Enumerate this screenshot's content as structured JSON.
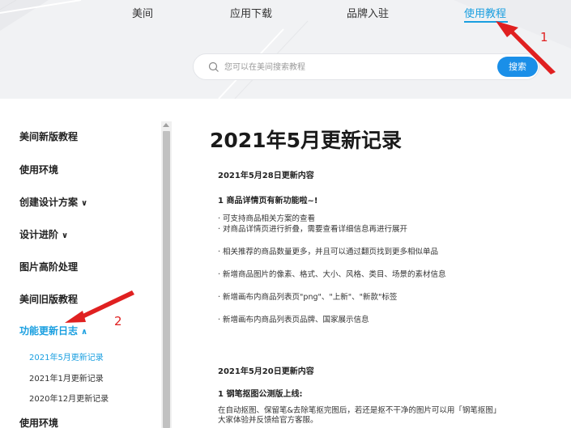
{
  "nav": {
    "items": [
      {
        "label": "美间",
        "active": false
      },
      {
        "label": "应用下载",
        "active": false
      },
      {
        "label": "品牌入驻",
        "active": false
      },
      {
        "label": "使用教程",
        "active": true
      }
    ]
  },
  "search": {
    "placeholder": "您可以在美间搜索教程",
    "button_label": "搜索"
  },
  "sidebar": {
    "items": [
      {
        "label": "美间新版教程"
      },
      {
        "label": "使用环境"
      },
      {
        "label": "创建设计方案",
        "caret": "∨"
      },
      {
        "label": "设计进阶",
        "caret": "∨"
      },
      {
        "label": "图片高阶处理"
      },
      {
        "label": "美间旧版教程"
      },
      {
        "label": "功能更新日志",
        "caret": "∧",
        "active": true
      }
    ],
    "sub_items": [
      {
        "label": "2021年5月更新记录",
        "active": true
      },
      {
        "label": "2021年1月更新记录"
      },
      {
        "label": "2020年12月更新记录"
      }
    ],
    "footer_item": "使用环境"
  },
  "content": {
    "title": "2021年5月更新记录",
    "section1": {
      "heading": "2021年5月28日更新内容",
      "subheading": "1 商品详情页有新功能啦~!",
      "lines": [
        "· 可支持商品相关方案的查看",
        "· 对商品详情页进行折叠，需要查看详细信息再进行展开",
        "· 相关推荐的商品数量更多，并且可以通过翻页找到更多相似单品",
        "· 新增商品图片的像素、格式、大小、风格、类目、场景的素材信息",
        "· 新增画布内商品列表页\"png\"、\"上新\"、\"新款\"标签",
        "· 新增画布内商品列表页品牌、国家展示信息"
      ]
    },
    "section2": {
      "heading": "2021年5月20日更新内容",
      "subheading": "1 钢笔抠图公测版上线:",
      "lines": [
        "在自动抠图、保留笔&去除笔抠完图后，若还是抠不干净的图片可以用「钢笔抠图」",
        "大家体验并反馈给官方客服。"
      ]
    }
  },
  "annotations": {
    "marker1": "1",
    "marker2": "2",
    "color": "#e02020"
  },
  "colors": {
    "accent": "#1a9fe0",
    "search_button": "#1a8fe8",
    "header_bg": "#f1f2f4"
  }
}
